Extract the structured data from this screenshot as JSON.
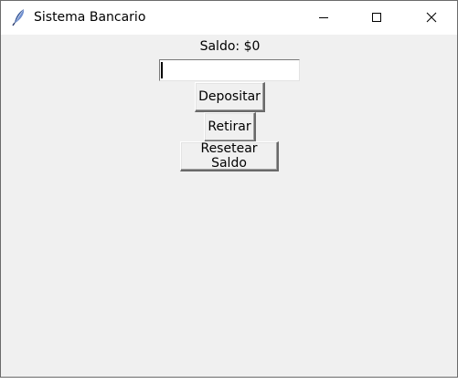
{
  "window": {
    "title": "Sistema Bancario",
    "icon": "feather-icon",
    "controls": {
      "minimize_icon": "minimize-icon",
      "maximize_icon": "maximize-icon",
      "close_icon": "close-icon"
    }
  },
  "main": {
    "balance_label": "Saldo: $0",
    "amount_input": {
      "value": "",
      "placeholder": ""
    },
    "buttons": {
      "deposit": "Depositar",
      "withdraw": "Retirar",
      "reset": "Resetear Saldo"
    }
  },
  "colors": {
    "background": "#f0f0f0",
    "titlebar": "#ffffff",
    "input_background": "#ffffff"
  }
}
